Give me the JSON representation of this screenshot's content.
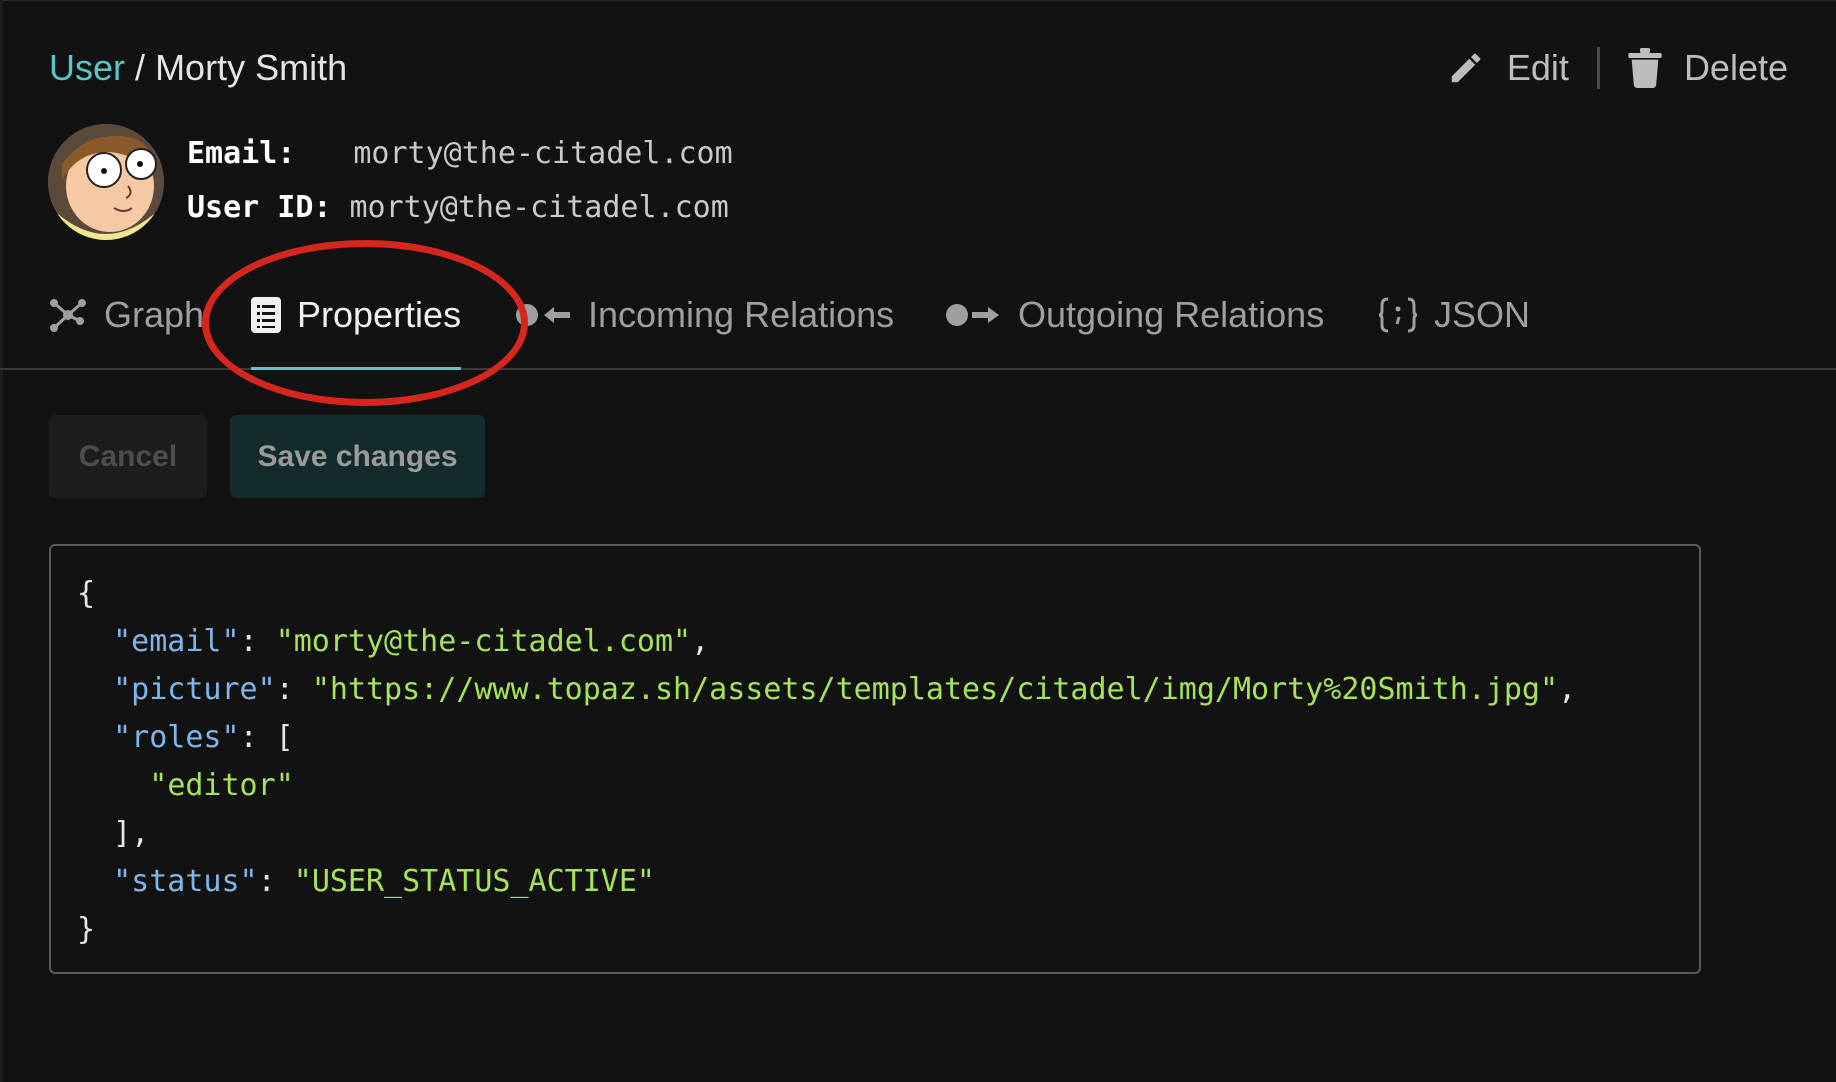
{
  "breadcrumb": {
    "parent": "User",
    "separator": "/",
    "current": "Morty Smith"
  },
  "actions": {
    "edit_label": "Edit",
    "delete_label": "Delete"
  },
  "info": {
    "email_label": "Email:",
    "email_value": "morty@the-citadel.com",
    "userid_label": "User ID:",
    "userid_value": "morty@the-citadel.com"
  },
  "tabs": [
    {
      "label": "Graph",
      "icon": "graph-icon",
      "active": false
    },
    {
      "label": "Properties",
      "icon": "document-icon",
      "active": true
    },
    {
      "label": "Incoming Relations",
      "icon": "incoming-arrow-icon",
      "active": false
    },
    {
      "label": "Outgoing Relations",
      "icon": "outgoing-arrow-icon",
      "active": false
    },
    {
      "label": "JSON",
      "icon": "braces-icon",
      "active": false
    }
  ],
  "buttons": {
    "cancel_label": "Cancel",
    "save_label": "Save changes"
  },
  "editor": {
    "properties": {
      "email": "morty@the-citadel.com",
      "picture": "https://www.topaz.sh/assets/templates/citadel/img/Morty%20Smith.jpg",
      "roles": [
        "editor"
      ],
      "status": "USER_STATUS_ACTIVE"
    }
  },
  "colors": {
    "background": "#121212",
    "accent": "#5cc6c6",
    "annotation": "#d7261e",
    "json_key": "#7fb5e8",
    "json_string": "#a6e35a"
  }
}
